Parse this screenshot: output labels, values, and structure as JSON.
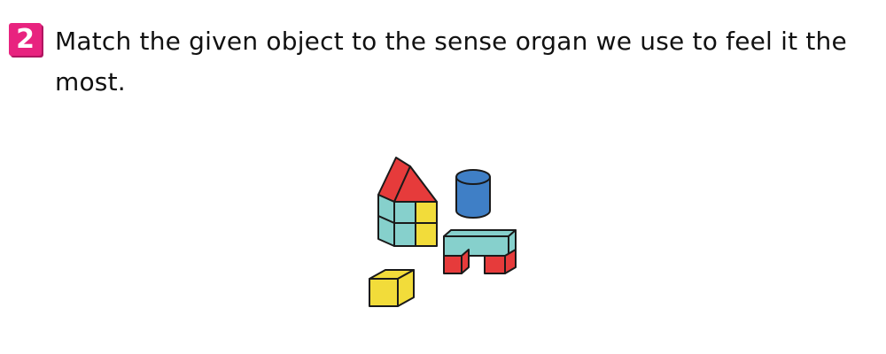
{
  "question": {
    "number": "2",
    "text": "Match the given object to the sense organ we use to feel it the most."
  },
  "illustration": {
    "subject": "toy building blocks",
    "colors": {
      "red": "#e63b3b",
      "teal": "#86d0cc",
      "yellow": "#f2dc3a",
      "blue": "#3f7fc6",
      "badge": "#e8237f",
      "outline": "#1a1a1a"
    }
  }
}
